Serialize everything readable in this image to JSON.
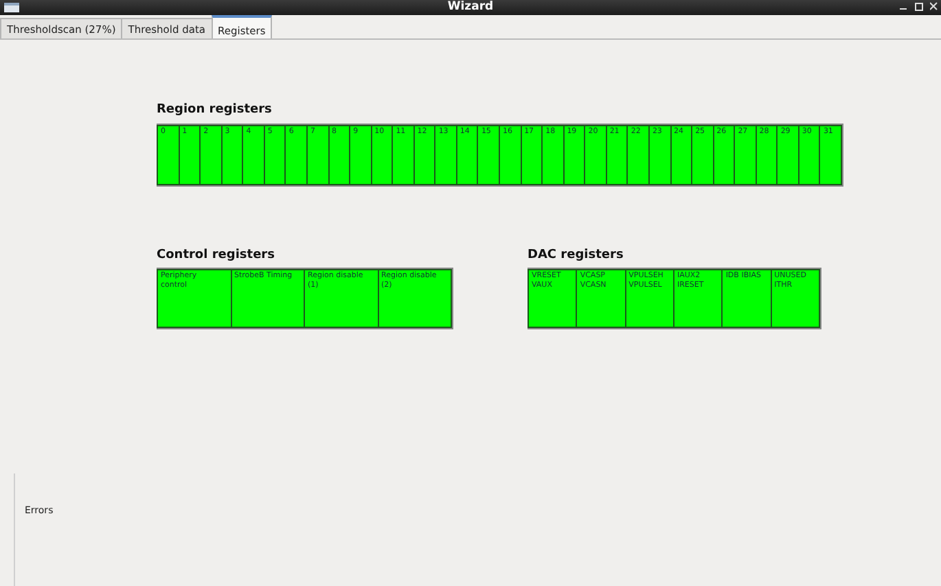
{
  "window": {
    "title": "Wizard"
  },
  "tabs": [
    {
      "label": "Thresholdscan (27%)",
      "selected": false
    },
    {
      "label": "Threshold data",
      "selected": false
    },
    {
      "label": "Registers",
      "selected": true
    }
  ],
  "region_registers": {
    "title": "Region registers",
    "cells": [
      {
        "label": "0",
        "color": "#00ff00"
      },
      {
        "label": "1",
        "color": "#00ff00"
      },
      {
        "label": "2",
        "color": "#00ff00"
      },
      {
        "label": "3",
        "color": "#00ff00"
      },
      {
        "label": "4",
        "color": "#00ff00"
      },
      {
        "label": "5",
        "color": "#00ff00"
      },
      {
        "label": "6",
        "color": "#00ff00"
      },
      {
        "label": "7",
        "color": "#00ff00"
      },
      {
        "label": "8",
        "color": "#00ff00"
      },
      {
        "label": "9",
        "color": "#00ff00"
      },
      {
        "label": "10",
        "color": "#00ff00"
      },
      {
        "label": "11",
        "color": "#00ff00"
      },
      {
        "label": "12",
        "color": "#00ff00"
      },
      {
        "label": "13",
        "color": "#00ff00"
      },
      {
        "label": "14",
        "color": "#00ff00"
      },
      {
        "label": "15",
        "color": "#00ff00"
      },
      {
        "label": "16",
        "color": "#00ff00"
      },
      {
        "label": "17",
        "color": "#00ff00"
      },
      {
        "label": "18",
        "color": "#00ff00"
      },
      {
        "label": "19",
        "color": "#00ff00"
      },
      {
        "label": "20",
        "color": "#00ff00"
      },
      {
        "label": "21",
        "color": "#00ff00"
      },
      {
        "label": "22",
        "color": "#00ff00"
      },
      {
        "label": "23",
        "color": "#00ff00"
      },
      {
        "label": "24",
        "color": "#00ff00"
      },
      {
        "label": "25",
        "color": "#00ff00"
      },
      {
        "label": "26",
        "color": "#00ff00"
      },
      {
        "label": "27",
        "color": "#00ff00"
      },
      {
        "label": "28",
        "color": "#00ff00"
      },
      {
        "label": "29",
        "color": "#00ff00"
      },
      {
        "label": "30",
        "color": "#00ff00"
      },
      {
        "label": "31",
        "color": "#00ff00"
      }
    ]
  },
  "control_registers": {
    "title": "Control registers",
    "cells": [
      {
        "label": "Periphery\ncontrol",
        "color": "#00ff00"
      },
      {
        "label": "StrobeB Timing",
        "color": "#00ff00"
      },
      {
        "label": "Region disable\n(1)",
        "color": "#00ff00"
      },
      {
        "label": "Region disable\n(2)",
        "color": "#00ff00"
      }
    ]
  },
  "dac_registers": {
    "title": "DAC registers",
    "cells": [
      {
        "label": "VRESET\nVAUX",
        "color": "#00ff00"
      },
      {
        "label": "VCASP\nVCASN",
        "color": "#00ff00"
      },
      {
        "label": "VPULSEH\nVPULSEL",
        "color": "#00ff00"
      },
      {
        "label": "IAUX2\nIRESET",
        "color": "#00ff00"
      },
      {
        "label": "IDB IBIAS",
        "color": "#00ff00"
      },
      {
        "label": "UNUSED\nITHR",
        "color": "#00ff00"
      }
    ]
  },
  "errors": {
    "label": "Errors"
  }
}
